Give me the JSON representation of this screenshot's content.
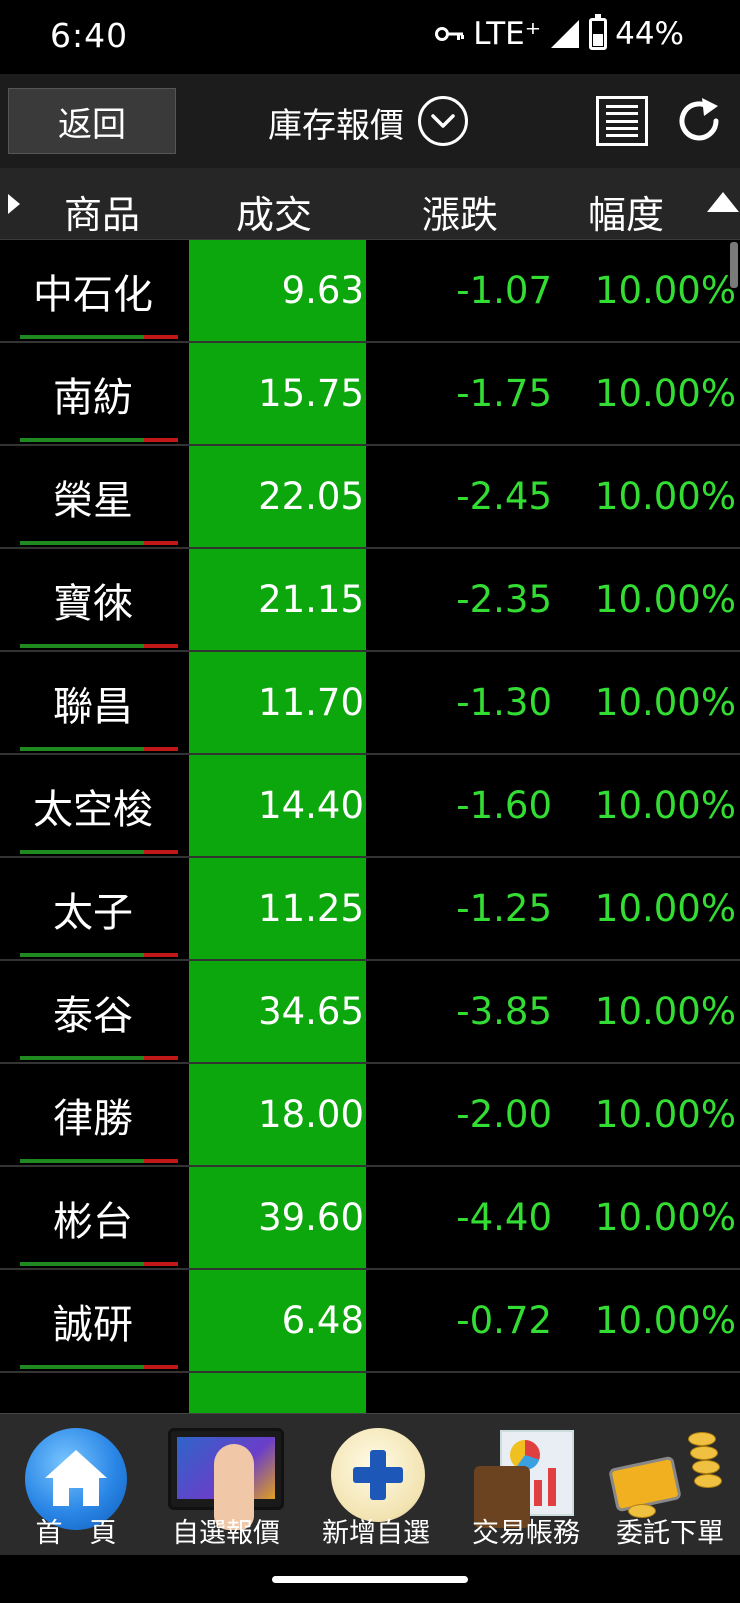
{
  "status_bar": {
    "time": "6:40",
    "network": "LTE⁺",
    "battery": "44%"
  },
  "nav": {
    "back_label": "返回",
    "title": "庫存報價"
  },
  "table": {
    "headers": [
      "商品",
      "成交",
      "漲跌",
      "幅度"
    ],
    "rows": [
      {
        "name": "中石化",
        "price": "9.63",
        "change": "-1.07",
        "pct": "10.00%"
      },
      {
        "name": "南紡",
        "price": "15.75",
        "change": "-1.75",
        "pct": "10.00%"
      },
      {
        "name": "榮星",
        "price": "22.05",
        "change": "-2.45",
        "pct": "10.00%"
      },
      {
        "name": "寶徠",
        "price": "21.15",
        "change": "-2.35",
        "pct": "10.00%"
      },
      {
        "name": "聯昌",
        "price": "11.70",
        "change": "-1.30",
        "pct": "10.00%"
      },
      {
        "name": "太空梭",
        "price": "14.40",
        "change": "-1.60",
        "pct": "10.00%"
      },
      {
        "name": "太子",
        "price": "11.25",
        "change": "-1.25",
        "pct": "10.00%"
      },
      {
        "name": "泰谷",
        "price": "34.65",
        "change": "-3.85",
        "pct": "10.00%"
      },
      {
        "name": "律勝",
        "price": "18.00",
        "change": "-2.00",
        "pct": "10.00%"
      },
      {
        "name": "彬台",
        "price": "39.60",
        "change": "-4.40",
        "pct": "10.00%"
      },
      {
        "name": "誠研",
        "price": "6.48",
        "change": "-0.72",
        "pct": "10.00%"
      }
    ]
  },
  "bottom_nav": {
    "home": "首　頁",
    "watchlist": "自選報價",
    "add_watch": "新增自選",
    "account": "交易帳務",
    "order": "委託下單"
  },
  "colors": {
    "price_bg": "#0ca70c",
    "down_text": "#33dd33",
    "header_bg": "#262626"
  },
  "icons": {
    "back": "back-button",
    "dropdown": "chevron-down-circle-icon",
    "menu": "list-menu-icon",
    "refresh": "refresh-icon",
    "sort": "sort-ascending-icon"
  }
}
